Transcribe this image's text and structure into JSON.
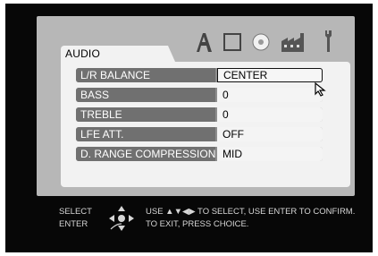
{
  "menu": {
    "tab_title": "AUDIO",
    "tab_icons": [
      "audio-letter-icon",
      "window-icon",
      "disc-icon",
      "factory-icon",
      "wrench-icon"
    ],
    "rows": [
      {
        "label": "L/R BALANCE",
        "value": "CENTER"
      },
      {
        "label": "BASS",
        "value": "0"
      },
      {
        "label": "TREBLE",
        "value": "0"
      },
      {
        "label": "LFE ATT.",
        "value": "OFF"
      },
      {
        "label": "D. RANGE COMPRESSION",
        "value": "MID"
      }
    ]
  },
  "footer": {
    "select_label": "SELECT",
    "enter_label": "ENTER",
    "instruction_line1": "USE ▲▼◀▶ TO SELECT,  USE ENTER TO CONFIRM.",
    "instruction_line2": "TO EXIT, PRESS CHOICE."
  },
  "colors": {
    "background": "#070707",
    "panel": "#b7b7b7",
    "content": "#f2f2f2",
    "label_bar": "#707070"
  }
}
